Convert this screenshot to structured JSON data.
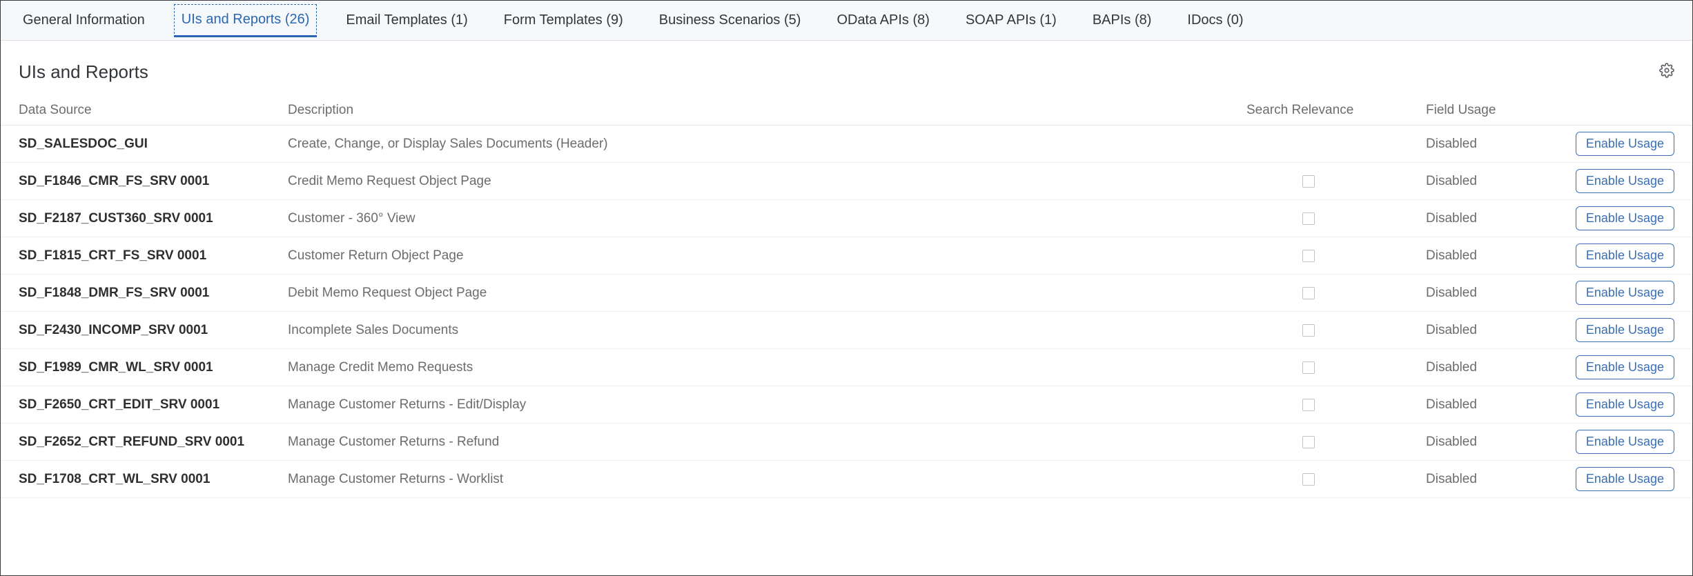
{
  "tabs": [
    {
      "label": "General Information",
      "active": false
    },
    {
      "label": "UIs and Reports (26)",
      "active": true
    },
    {
      "label": "Email Templates (1)",
      "active": false
    },
    {
      "label": "Form Templates (9)",
      "active": false
    },
    {
      "label": "Business Scenarios (5)",
      "active": false
    },
    {
      "label": "OData APIs (8)",
      "active": false
    },
    {
      "label": "SOAP APIs (1)",
      "active": false
    },
    {
      "label": "BAPIs (8)",
      "active": false
    },
    {
      "label": "IDocs (0)",
      "active": false
    }
  ],
  "section": {
    "title": "UIs and Reports"
  },
  "columns": {
    "data_source": "Data Source",
    "description": "Description",
    "search_relevance": "Search Relevance",
    "field_usage": "Field Usage"
  },
  "action_label": "Enable Usage",
  "rows": [
    {
      "data_source": "SD_SALESDOC_GUI",
      "description": "Create, Change, or Display Sales Documents (Header)",
      "search_relevance_checkbox": false,
      "field_usage": "Disabled"
    },
    {
      "data_source": "SD_F1846_CMR_FS_SRV 0001",
      "description": "Credit Memo Request Object Page",
      "search_relevance_checkbox": true,
      "field_usage": "Disabled"
    },
    {
      "data_source": "SD_F2187_CUST360_SRV 0001",
      "description": "Customer - 360° View",
      "search_relevance_checkbox": true,
      "field_usage": "Disabled"
    },
    {
      "data_source": "SD_F1815_CRT_FS_SRV 0001",
      "description": "Customer Return Object Page",
      "search_relevance_checkbox": true,
      "field_usage": "Disabled"
    },
    {
      "data_source": "SD_F1848_DMR_FS_SRV 0001",
      "description": "Debit Memo Request Object Page",
      "search_relevance_checkbox": true,
      "field_usage": "Disabled"
    },
    {
      "data_source": "SD_F2430_INCOMP_SRV 0001",
      "description": "Incomplete Sales Documents",
      "search_relevance_checkbox": true,
      "field_usage": "Disabled"
    },
    {
      "data_source": "SD_F1989_CMR_WL_SRV 0001",
      "description": "Manage Credit Memo Requests",
      "search_relevance_checkbox": true,
      "field_usage": "Disabled"
    },
    {
      "data_source": "SD_F2650_CRT_EDIT_SRV 0001",
      "description": "Manage Customer Returns - Edit/Display",
      "search_relevance_checkbox": true,
      "field_usage": "Disabled"
    },
    {
      "data_source": "SD_F2652_CRT_REFUND_SRV 0001",
      "description": "Manage Customer Returns - Refund",
      "search_relevance_checkbox": true,
      "field_usage": "Disabled"
    },
    {
      "data_source": "SD_F1708_CRT_WL_SRV 0001",
      "description": "Manage Customer Returns - Worklist",
      "search_relevance_checkbox": true,
      "field_usage": "Disabled"
    }
  ]
}
